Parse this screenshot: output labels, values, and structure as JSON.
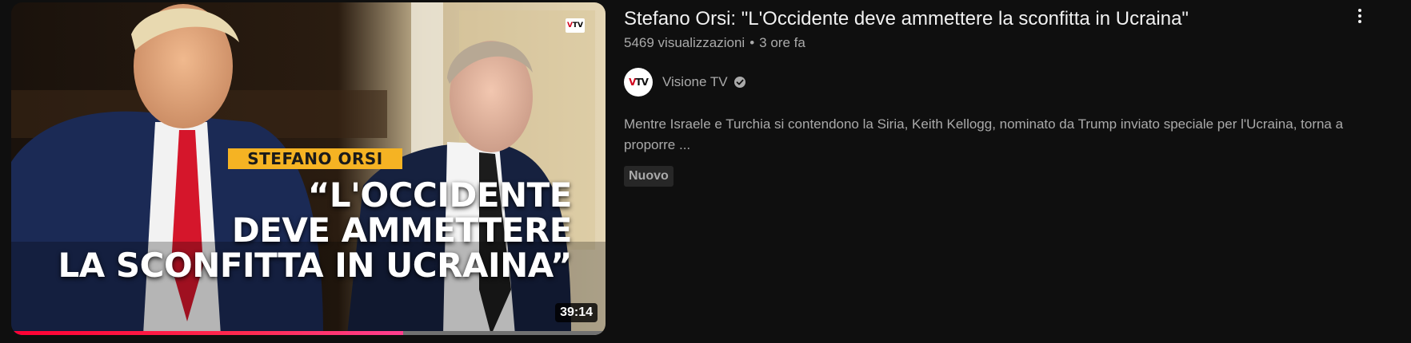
{
  "video": {
    "title": "Stefano Orsi: \"L'Occidente deve ammettere la sconfitta in Ucraina\"",
    "views": "5469 visualizzazioni",
    "separator": "•",
    "age": "3 ore fa",
    "duration": "39:14",
    "watch_progress_percent": 66,
    "badge": "Nuovo",
    "description": "Mentre Israele e Turchia si contendono la Siria, Keith Kellogg, nominato da Trump inviato speciale per l'Ucraina, torna a proporre ..."
  },
  "thumbnail": {
    "banner_name": "STEFANO ORSI",
    "quote_lines": [
      "“L'OCCIDENTE",
      "DEVE AMMETTERE",
      "LA SCONFITTA IN UCRAINA”"
    ],
    "logo_v": "V",
    "logo_tv": "TV"
  },
  "channel": {
    "name": "Visione TV",
    "avatar_v": "V",
    "avatar_tv": "TV",
    "verified": true
  },
  "icons": {
    "menu": "more-vert-icon",
    "verified": "verified-check-icon"
  },
  "colors": {
    "background": "#0f0f0f",
    "title_text": "#f1f1f1",
    "secondary_text": "#aaaaaa",
    "progress": "#ff0033",
    "banner": "#f5b323",
    "badge_bg": "#272727"
  }
}
